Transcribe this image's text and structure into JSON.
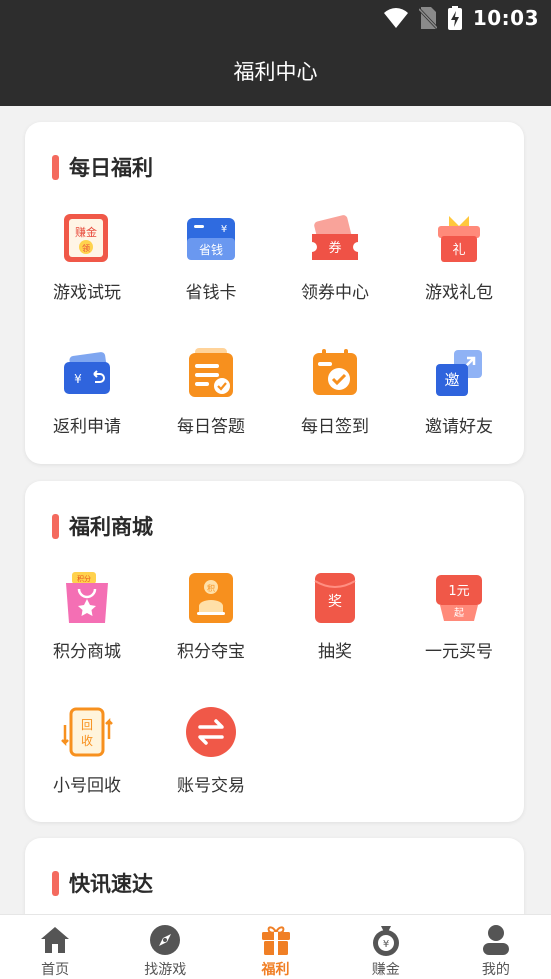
{
  "status_bar": {
    "time": "10:03"
  },
  "header": {
    "title": "福利中心"
  },
  "sections": {
    "daily": {
      "title": "每日福利",
      "items": [
        {
          "label": "游戏试玩",
          "icon": "trial-play-icon"
        },
        {
          "label": "省钱卡",
          "icon": "money-saving-card-icon",
          "icon_text": "省钱"
        },
        {
          "label": "领券中心",
          "icon": "coupon-center-icon",
          "icon_text": "券"
        },
        {
          "label": "游戏礼包",
          "icon": "gift-pack-icon",
          "icon_text": "礼"
        },
        {
          "label": "返利申请",
          "icon": "rebate-wallet-icon"
        },
        {
          "label": "每日答题",
          "icon": "daily-quiz-icon"
        },
        {
          "label": "每日签到",
          "icon": "daily-checkin-icon"
        },
        {
          "label": "邀请好友",
          "icon": "invite-friends-icon",
          "icon_text": "邀"
        }
      ],
      "trial_icon_text": [
        "赚金",
        "领"
      ]
    },
    "mall": {
      "title": "福利商城",
      "items": [
        {
          "label": "积分商城",
          "icon": "points-mall-bag-icon",
          "icon_text": "积分"
        },
        {
          "label": "积分夺宝",
          "icon": "points-treasure-icon",
          "icon_text": "积"
        },
        {
          "label": "抽奖",
          "icon": "lottery-icon",
          "icon_text": "奖"
        },
        {
          "label": "一元买号",
          "icon": "one-yuan-buy-icon",
          "icon_text": "1元",
          "icon_subtext": "起"
        },
        {
          "label": "小号回收",
          "icon": "account-recycle-icon",
          "icon_text": "回",
          "icon_subtext": "收"
        },
        {
          "label": "账号交易",
          "icon": "account-trade-icon"
        }
      ]
    },
    "news": {
      "title": "快讯速达"
    }
  },
  "tabs": [
    {
      "label": "首页",
      "icon": "home-icon"
    },
    {
      "label": "找游戏",
      "icon": "compass-icon"
    },
    {
      "label": "福利",
      "icon": "gift-icon",
      "active": true
    },
    {
      "label": "赚金",
      "icon": "money-bag-icon",
      "icon_text": "¥"
    },
    {
      "label": "我的",
      "icon": "profile-icon"
    }
  ],
  "colors": {
    "header_bg": "#2d2d2d",
    "accent_red": "#f46a5e",
    "active_orange": "#f07f25"
  }
}
